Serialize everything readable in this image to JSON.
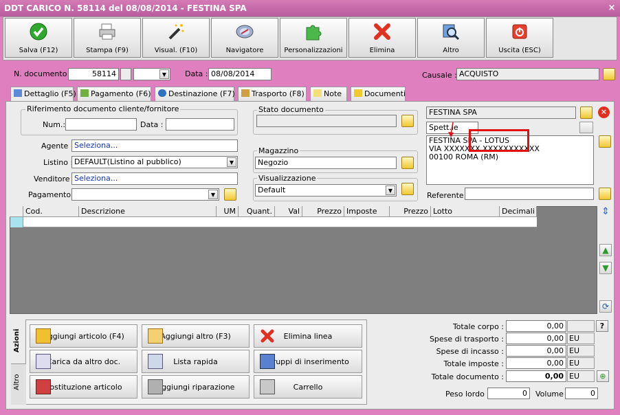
{
  "window": {
    "title": "DDT CARICO N. 58114 del 08/08/2014 - FESTINA SPA",
    "close_glyph": "×"
  },
  "toolbar": [
    {
      "label": "Salva (F12)",
      "icon": "check-icon"
    },
    {
      "label": "Stampa (F9)",
      "icon": "printer-icon"
    },
    {
      "label": "Visual. (F10)",
      "icon": "magic-wand-icon"
    },
    {
      "label": "Navigatore",
      "icon": "compass-icon"
    },
    {
      "label": "Personalizzazioni",
      "icon": "puzzle-icon"
    },
    {
      "label": "Elimina",
      "icon": "delete-x-icon"
    },
    {
      "label": "Altro",
      "icon": "magnifier-icon"
    },
    {
      "label": "Uscita (ESC)",
      "icon": "power-icon"
    }
  ],
  "header": {
    "doc_num_label": "N. documento :",
    "doc_num": "58114",
    "data_label": "Data :",
    "data": "08/08/2014",
    "causale_label": "Causale :",
    "causale": "ACQUISTO"
  },
  "tabs": [
    "Dettaglio (F5)",
    "Pagamento (F6)",
    "Destinazione (F7)",
    "Trasporto (F8)",
    "Note",
    "Documenti"
  ],
  "rif": {
    "title": "Riferimento documento cliente/fornitore",
    "num_label": "Num.:",
    "data_label": "Data :"
  },
  "fields": {
    "agente_label": "Agente :",
    "agente": "Seleziona...",
    "listino_label": "Listino :",
    "listino": "DEFAULT(Listino al pubblico)",
    "venditore_label": "Venditore :",
    "venditore": "Seleziona...",
    "pagamento_label": "Pagamento :"
  },
  "stato": {
    "title": "Stato documento"
  },
  "magazzino": {
    "title": "Magazzino",
    "value": "Negozio"
  },
  "visual": {
    "title": "Visualizzazione",
    "value": "Default"
  },
  "cliente": {
    "name": "FESTINA SPA",
    "spett": "Spett.le",
    "address": [
      "FESTINA SPA - LOTUS",
      "VIA XXXXXXX XXXXXXXXXXX",
      "00100 ROMA (RM)"
    ],
    "referente_label": "Referente"
  },
  "grid": {
    "columns": [
      "Cod.",
      "Descrizione",
      "UM",
      "Quant.",
      "Val",
      "Prezzo",
      "Imposte",
      "Prezzo",
      "Lotto",
      "Decimali"
    ]
  },
  "actions": {
    "side_tabs": [
      "Azioni",
      "Altro"
    ],
    "buttons": [
      "Aggiungi articolo (F4)",
      "Aggiungi altro (F3)",
      "Elimina linea",
      "Carica da altro doc.",
      "Lista rapida",
      "Gruppi di inserimento",
      "Sostituzione articolo",
      "Aggiungi riparazione",
      "Carrello"
    ]
  },
  "totals": {
    "rows": [
      {
        "label": "Totale corpo :",
        "value": "0,00",
        "unit": ""
      },
      {
        "label": "Spese di trasporto :",
        "value": "0,00",
        "unit": "EU"
      },
      {
        "label": "Spese di incasso :",
        "value": "0,00",
        "unit": "EU"
      },
      {
        "label": "Totale imposte :",
        "value": "0,00",
        "unit": "EU"
      },
      {
        "label": "Totale documento :",
        "value": "0,00",
        "unit": "EU"
      }
    ],
    "peso_label": "Peso lordo :",
    "peso": "0",
    "volume_label": "Volume :",
    "volume": "0",
    "help": "?"
  },
  "colors": {
    "title": "#c06aa6",
    "accent_red": "#e01010"
  }
}
